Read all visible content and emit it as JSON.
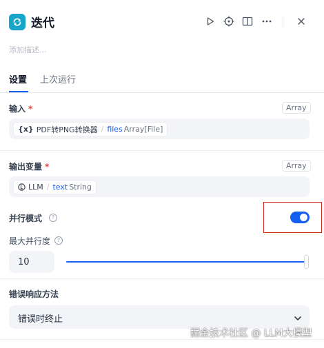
{
  "header": {
    "title": "迭代",
    "icons": [
      "loop-icon",
      "play-icon",
      "locate-icon",
      "book-icon",
      "more-icon",
      "close-icon"
    ]
  },
  "description_placeholder": "添加描述...",
  "tabs": [
    {
      "label": "设置",
      "active": true
    },
    {
      "label": "上次运行",
      "active": false
    }
  ],
  "input_section": {
    "label": "输入",
    "required_mark": "*",
    "type_badge": "Array",
    "variable": {
      "prefix_icon": "{x}",
      "node": "PDF转PNG转换器",
      "separator": "/",
      "name": "files",
      "type": "Array[File]"
    }
  },
  "output_section": {
    "label": "输出变量",
    "required_mark": "*",
    "type_badge": "Array",
    "variable": {
      "prefix_icon": "llm-icon",
      "node": "LLM",
      "separator": "/",
      "name": "text",
      "type": "String"
    }
  },
  "parallel": {
    "label": "并行模式",
    "enabled": true,
    "max_label": "最大并行度",
    "max_value": "10",
    "slider_fraction": 1.0
  },
  "error_section": {
    "label": "错误响应方法",
    "selected": "错误时终止"
  },
  "watermark": "掘金技术社区 @ LLM大模型",
  "colors": {
    "accent": "#155eef",
    "node_icon": "#17a6c9",
    "required": "#e0463c",
    "highlight_box": "#d92d20"
  }
}
